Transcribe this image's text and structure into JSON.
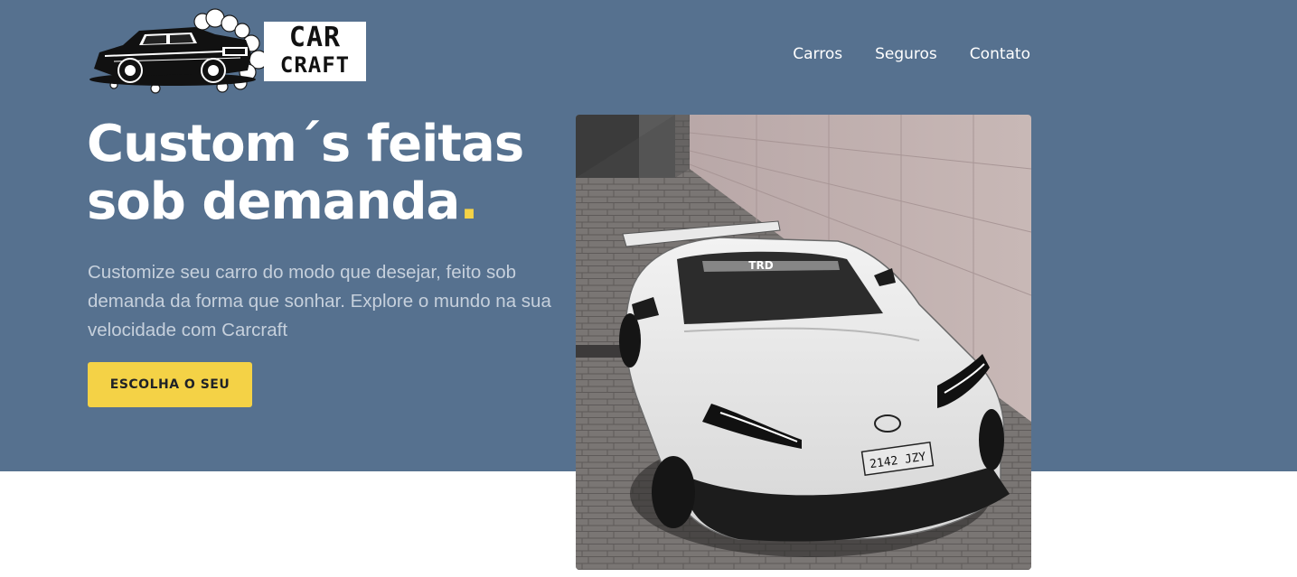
{
  "brand": {
    "line1": "CAR",
    "line2": "CRAFT",
    "logo_icon": "muscle-car-icon"
  },
  "nav": {
    "items": [
      "Carros",
      "Seguros",
      "Contato"
    ]
  },
  "hero": {
    "headline_line1": "Custom´s feitas",
    "headline_line2": "sob demanda",
    "headline_dot": ".",
    "description": "Customize seu carro do modo que desejar, feito sob demanda da forma que sonhar. Explore o mundo na sua velocidade com Carcraft",
    "cta_label": "ESCOLHA O SEU"
  },
  "photo": {
    "plate": "2142 JZY",
    "windshield_text": "TRD"
  },
  "colors": {
    "hero_background": "#56718f",
    "accent": "#f4d246",
    "text_light": "#ffffff",
    "text_muted": "#c6d0dc",
    "page_background": "#ffffff"
  }
}
